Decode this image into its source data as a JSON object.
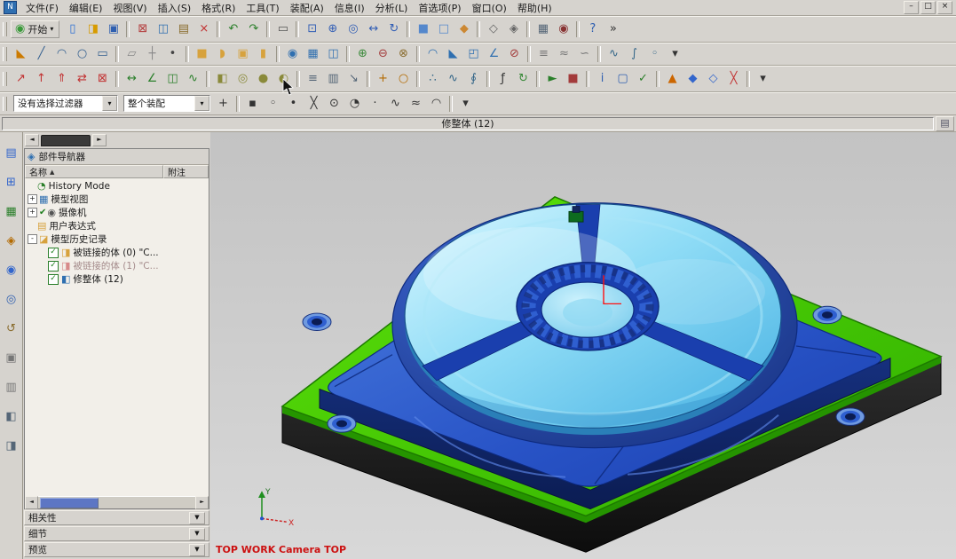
{
  "window": {
    "app_icon_glyph": "N",
    "buttons": [
      {
        "id": "minimize",
        "glyph": "–"
      },
      {
        "id": "maximize",
        "glyph": "□"
      },
      {
        "id": "close",
        "glyph": "×"
      }
    ]
  },
  "menubar": {
    "items": [
      {
        "id": "file",
        "label": "文件(F)"
      },
      {
        "id": "edit",
        "label": "编辑(E)"
      },
      {
        "id": "view",
        "label": "视图(V)"
      },
      {
        "id": "insert",
        "label": "插入(S)"
      },
      {
        "id": "format",
        "label": "格式(R)"
      },
      {
        "id": "tools",
        "label": "工具(T)"
      },
      {
        "id": "assemblies",
        "label": "装配(A)"
      },
      {
        "id": "information",
        "label": "信息(I)"
      },
      {
        "id": "analysis",
        "label": "分析(L)"
      },
      {
        "id": "preferences",
        "label": "首选项(P)"
      },
      {
        "id": "window",
        "label": "窗口(O)"
      },
      {
        "id": "help",
        "label": "帮助(H)"
      }
    ]
  },
  "toolbars": {
    "start": {
      "label": "开始",
      "glyph": "◉",
      "glyph_color": "#3a9a3a",
      "dropdown": "▾"
    },
    "row1": [
      [
        "new-file",
        "▯",
        "#2b6fd4"
      ],
      [
        "open-file",
        "◨",
        "#d79b00"
      ],
      [
        "save",
        "▣",
        "#2f5fb0"
      ],
      "|",
      [
        "cut",
        "⊠",
        "#b33b3b"
      ],
      [
        "copy",
        "◫",
        "#2f6fb0"
      ],
      [
        "paste",
        "▤",
        "#8a6d2f"
      ],
      [
        "delete",
        "×",
        "#c23232"
      ],
      "|",
      [
        "undo",
        "↶",
        "#2a7f2a"
      ],
      [
        "redo",
        "↷",
        "#2a7f2a"
      ],
      "|",
      [
        "print",
        "▭",
        "#555555"
      ],
      "|",
      [
        "fit-view",
        "⊡",
        "#335fb5"
      ],
      [
        "zoom-in-out",
        "⊕",
        "#335fb5"
      ],
      [
        "zoom-window",
        "◎",
        "#335fb5"
      ],
      [
        "pan",
        "↔",
        "#335fb5"
      ],
      [
        "rotate-view",
        "↻",
        "#335fb5"
      ],
      "|",
      [
        "shaded-with-edges",
        "■",
        "#5588cc"
      ],
      [
        "wireframe",
        "□",
        "#5588cc"
      ],
      [
        "studio-render",
        "◆",
        "#cc8833"
      ],
      "|",
      [
        "isometric-view",
        "◇",
        "#666666"
      ],
      [
        "trimetric-view",
        "◈",
        "#666666"
      ],
      "|",
      [
        "window-menu",
        "▦",
        "#556677"
      ],
      [
        "snapshot",
        "◉",
        "#883333"
      ],
      "|",
      [
        "help",
        "?",
        "#2f5fb0"
      ],
      [
        "toolbar-options",
        "»",
        "#333333"
      ]
    ],
    "row2": [
      [
        "direct-sketch",
        "◣",
        "#cc7a00"
      ],
      [
        "sketch-curve",
        "╱",
        "#335f8f"
      ],
      [
        "arc",
        "◠",
        "#335f8f"
      ],
      [
        "circle",
        "○",
        "#335f8f"
      ],
      [
        "rectangle",
        "▭",
        "#335f8f"
      ],
      "|",
      [
        "datum-plane",
        "▱",
        "#888888"
      ],
      [
        "datum-axis",
        "┼",
        "#888888"
      ],
      [
        "point",
        "•",
        "#444444"
      ],
      "|",
      [
        "extrude",
        "■",
        "#d7a23d"
      ],
      [
        "revolve",
        "◗",
        "#d7a23d"
      ],
      [
        "block",
        "▣",
        "#d7a23d"
      ],
      [
        "cylinder",
        "▮",
        "#d7a23d"
      ],
      "|",
      [
        "hole",
        "◉",
        "#2f6fb0"
      ],
      [
        "pattern-feature",
        "▦",
        "#2f6fb0"
      ],
      [
        "mirror-feature",
        "◫",
        "#2f6fb0"
      ],
      "|",
      [
        "unite",
        "⊕",
        "#3a8a3a"
      ],
      [
        "subtract",
        "⊖",
        "#a33b3b"
      ],
      [
        "intersect",
        "⊗",
        "#8a6d2f"
      ],
      "|",
      [
        "edge-blend",
        "◠",
        "#2f6fb0"
      ],
      [
        "chamfer",
        "◣",
        "#2f6fb0"
      ],
      [
        "shell",
        "◰",
        "#2f6fb0"
      ],
      [
        "draft",
        "∠",
        "#2f6fb0"
      ],
      [
        "trim-body-tool",
        "⊘",
        "#a33b3b"
      ],
      "|",
      [
        "thicken",
        "≡",
        "#777777"
      ],
      [
        "sew",
        "≈",
        "#777777"
      ],
      [
        "offset-surface",
        "∽",
        "#777777"
      ],
      "|",
      [
        "through-curves",
        "∿",
        "#346688"
      ],
      [
        "swept",
        "∫",
        "#346688"
      ],
      [
        "tube",
        "◦",
        "#346688"
      ],
      [
        "more-features",
        "▾",
        "#333333"
      ]
    ],
    "row3": [
      [
        "move-face",
        "↗",
        "#c23232"
      ],
      [
        "pull-face",
        "↑",
        "#c23232"
      ],
      [
        "offset-region",
        "⇑",
        "#c23232"
      ],
      [
        "replace-face",
        "⇄",
        "#c23232"
      ],
      [
        "delete-face",
        "⊠",
        "#c23232"
      ],
      "|",
      [
        "measure-distance",
        "↔",
        "#2a7f2a"
      ],
      [
        "measure-angle",
        "∠",
        "#2a7f2a"
      ],
      [
        "section-analysis",
        "◫",
        "#2a7f2a"
      ],
      [
        "curvature-analysis",
        "∿",
        "#2a7f2a"
      ],
      "|",
      [
        "edit-object-display",
        "◧",
        "#8a8a3a"
      ],
      [
        "show-hide",
        "◎",
        "#8a8a3a"
      ],
      [
        "immediate-hide",
        "●",
        "#8a8a3a"
      ],
      [
        "invert-shown",
        "◐",
        "#8a8a3a"
      ],
      "|",
      [
        "layer-settings",
        "≡",
        "#556677"
      ],
      [
        "visible-in-view",
        "▥",
        "#556677"
      ],
      [
        "move-to-layer",
        "↘",
        "#556677"
      ],
      "|",
      [
        "wcs-dynamics",
        "+",
        "#b36a00"
      ],
      [
        "wcs-orient",
        "○",
        "#b36a00"
      ],
      "|",
      [
        "point-set",
        "∴",
        "#346688"
      ],
      [
        "studio-spline",
        "∿",
        "#346688"
      ],
      [
        "helix",
        "∮",
        "#346688"
      ],
      "|",
      [
        "expression",
        "ƒ",
        "#333333"
      ],
      [
        "update-model",
        "↻",
        "#3a8a3a"
      ],
      "|",
      [
        "play",
        "►",
        "#2a7f2a"
      ],
      [
        "stop",
        "■",
        "#a33b3b"
      ],
      "|",
      [
        "information",
        "i",
        "#2f5fb0"
      ],
      [
        "boundary",
        "▢",
        "#2f5fb0"
      ],
      [
        "examine-geometry",
        "✓",
        "#2a7f2a"
      ],
      "|",
      [
        "mold-wizard",
        "▲",
        "#cc6600"
      ],
      [
        "core",
        "◆",
        "#3366cc"
      ],
      [
        "cavity",
        "◇",
        "#3366cc"
      ],
      [
        "parting-line",
        "╳",
        "#c23232"
      ],
      "|",
      [
        "customize",
        "▾",
        "#333333"
      ]
    ],
    "filters": {
      "selection_filter": "没有选择过滤器",
      "assembly_scope": "整个装配",
      "dropdown": "▾"
    },
    "row4_icons": [
      [
        "snap-point",
        "+",
        "#333333"
      ],
      "|",
      [
        "end-point",
        "▪",
        "#333333"
      ],
      [
        "mid-point",
        "◦",
        "#333333"
      ],
      [
        "control-point",
        "•",
        "#333333"
      ],
      [
        "intersection-point",
        "╳",
        "#333333"
      ],
      [
        "arc-center",
        "⊙",
        "#333333"
      ],
      [
        "quadrant-point",
        "◔",
        "#333333"
      ],
      [
        "existing-point",
        "·",
        "#333333"
      ],
      [
        "point-on-curve",
        "∿",
        "#333333"
      ],
      [
        "point-on-face",
        "≈",
        "#333333"
      ],
      [
        "tangent-point",
        "◠",
        "#333333"
      ],
      "|",
      [
        "snap-options",
        "▾",
        "#333333"
      ]
    ]
  },
  "status_bar": {
    "message": "修整体 (12)",
    "icon_glyph": "▤"
  },
  "left_strip": [
    [
      "assembly-navigator",
      "▤",
      "#3366cc"
    ],
    [
      "constraint-navigator",
      "⊞",
      "#3366cc"
    ],
    [
      "part-navigator",
      "▦",
      "#2a7f2a"
    ],
    [
      "reuse-library",
      "◈",
      "#b36a00"
    ],
    [
      "hd3d-tools",
      "◉",
      "#3366cc"
    ],
    [
      "web-browser",
      "◎",
      "#2f5fb0"
    ],
    [
      "history-palette",
      "↺",
      "#8a6d2f"
    ],
    [
      "process-studio",
      "▣",
      "#777777"
    ],
    [
      "manage-palette",
      "▥",
      "#777777"
    ],
    [
      "roles",
      "◧",
      "#556677"
    ],
    [
      "system-materials",
      "◨",
      "#556677"
    ]
  ],
  "navigator": {
    "title": "部件导航器",
    "title_icon_glyph": "◈",
    "tabs": {
      "back": "◄",
      "forward": "►"
    },
    "columns": [
      {
        "label": "名称",
        "sort": "▲"
      },
      {
        "label": "附注",
        "sort": ""
      }
    ],
    "scrollbar": {
      "left": "◄",
      "right": "►"
    },
    "tree": [
      {
        "id": "history-mode",
        "label": "History Mode",
        "level": 0,
        "expand": null,
        "check": false,
        "pre": "",
        "icon": "◔",
        "icon_color": "#2a7f2a",
        "dim": false
      },
      {
        "id": "model-views",
        "label": "模型视图",
        "level": 0,
        "expand": "+",
        "check": false,
        "pre": "",
        "icon": "▦",
        "icon_color": "#2f6fb0",
        "dim": false
      },
      {
        "id": "cameras",
        "label": "摄像机",
        "level": 0,
        "expand": "+",
        "check": false,
        "pre": "✔",
        "icon": "◉",
        "icon_color": "#555555",
        "dim": false
      },
      {
        "id": "user-expressions",
        "label": "用户表达式",
        "level": 0,
        "expand": null,
        "check": false,
        "pre": "",
        "icon": "▤",
        "icon_color": "#d7a23d",
        "dim": false
      },
      {
        "id": "model-history",
        "label": "模型历史记录",
        "level": 0,
        "expand": "-",
        "check": false,
        "pre": "",
        "icon": "◪",
        "icon_color": "#d7a23d",
        "dim": false
      },
      {
        "id": "linked-body-0",
        "label": "被链接的体 (0) \"C...",
        "level": 1,
        "expand": null,
        "check": true,
        "pre": "",
        "icon": "◨",
        "icon_color": "#d7a23d",
        "dim": false
      },
      {
        "id": "linked-body-1",
        "label": "被链接的体 (1) \"C...",
        "level": 1,
        "expand": null,
        "check": true,
        "pre": "",
        "icon": "◨",
        "icon_color": "#d78a8a",
        "dim": true
      },
      {
        "id": "trim-body-12",
        "label": "修整体 (12)",
        "level": 1,
        "expand": null,
        "check": true,
        "pre": "",
        "icon": "◧",
        "icon_color": "#2f6fb0",
        "dim": false
      }
    ]
  },
  "bottom_panels": [
    {
      "id": "dependencies",
      "label": "相关性",
      "chevron": "▼"
    },
    {
      "id": "details",
      "label": "细节",
      "chevron": "▼"
    },
    {
      "id": "preview",
      "label": "预览",
      "chevron": "▼"
    }
  ],
  "viewport": {
    "camera_label": "TOP WORK Camera TOP",
    "triad": {
      "x_label": "X",
      "y_label": "Y"
    }
  },
  "colors": {
    "base_green": "#3ecb00",
    "base_green_dark": "#1d7a00",
    "mold_blue": "#2853c6",
    "mold_blue_dark": "#0e2a7e",
    "disk_cyan": "#7fd8f5",
    "base_dark": "#161616",
    "accent_red": "#cc1111"
  }
}
